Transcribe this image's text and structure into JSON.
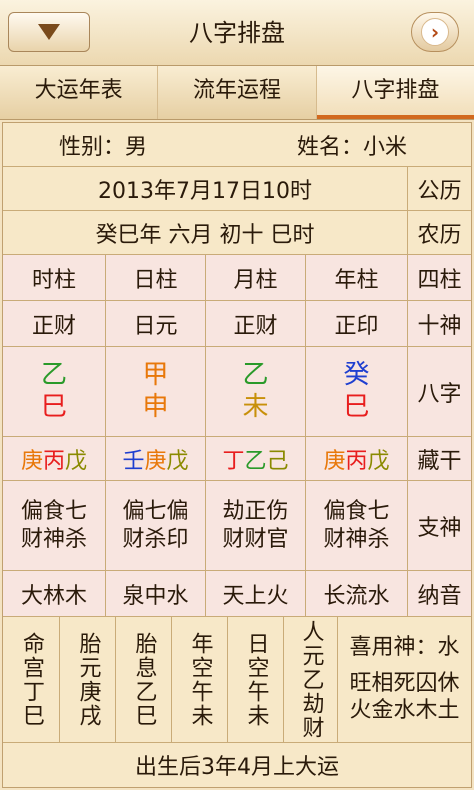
{
  "header": {
    "title": "八字排盘"
  },
  "tabs": [
    {
      "label": "八字排盘",
      "active": true
    },
    {
      "label": "流年运程",
      "active": false
    },
    {
      "label": "大运年表",
      "active": false
    }
  ],
  "info": {
    "name_label": "姓名：小米",
    "gender_label": "性别：男"
  },
  "calendar": {
    "solar_label": "公历",
    "solar_value": "2013年7月17日10时",
    "lunar_label": "农历",
    "lunar_value": "癸巳年 六月 初十 巳时"
  },
  "pillars": {
    "label": "四柱",
    "headers": [
      "年柱",
      "月柱",
      "日柱",
      "时柱"
    ]
  },
  "shishen": {
    "label": "十神",
    "values": [
      "正印",
      "正财",
      "日元",
      "正财"
    ]
  },
  "bazi": {
    "label": "八字",
    "items": [
      {
        "gan": "癸",
        "zhi": "巳",
        "gan_color": "#1f3fd0",
        "zhi_color": "#e81e1e"
      },
      {
        "gan": "乙",
        "zhi": "未",
        "gan_color": "#2a9a2a",
        "zhi_color": "#c8900a"
      },
      {
        "gan": "甲",
        "zhi": "申",
        "gan_color": "#e8780a",
        "zhi_color": "#e8780a"
      },
      {
        "gan": "乙",
        "zhi": "巳",
        "gan_color": "#2a9a2a",
        "zhi_color": "#e81e1e"
      }
    ]
  },
  "canggan": {
    "label": "藏干",
    "items": [
      [
        {
          "t": "庚",
          "c": "#e8780a"
        },
        {
          "t": "丙",
          "c": "#e81e1e"
        },
        {
          "t": "戊",
          "c": "#8a8a00"
        }
      ],
      [
        {
          "t": "丁",
          "c": "#e81e1e"
        },
        {
          "t": "乙",
          "c": "#2a9a2a"
        },
        {
          "t": "己",
          "c": "#8a8a00"
        }
      ],
      [
        {
          "t": "壬",
          "c": "#1f3fd0"
        },
        {
          "t": "庚",
          "c": "#e8780a"
        },
        {
          "t": "戊",
          "c": "#8a8a00"
        }
      ],
      [
        {
          "t": "庚",
          "c": "#e8780a"
        },
        {
          "t": "丙",
          "c": "#e81e1e"
        },
        {
          "t": "戊",
          "c": "#8a8a00"
        }
      ]
    ]
  },
  "zhishen": {
    "label": "支神",
    "items": [
      [
        "偏食七",
        "财神杀"
      ],
      [
        "劫正伤",
        "财财官"
      ],
      [
        "偏七偏",
        "财杀印"
      ],
      [
        "偏食七",
        "财神杀"
      ]
    ]
  },
  "nayin": {
    "label": "纳音",
    "values": [
      "长流水",
      "天上火",
      "泉中水",
      "大林木"
    ]
  },
  "extra": {
    "xiyong": "喜用神：水",
    "wangxiang_1": "旺相死囚休",
    "wangxiang_2": "火金水木土",
    "cols": [
      "人元乙劫财",
      "日空午未",
      "年空午未",
      "胎息乙巳",
      "胎元庚戌",
      "命宫丁巳"
    ]
  },
  "footer": {
    "text": "出生后3年4月上大运"
  }
}
